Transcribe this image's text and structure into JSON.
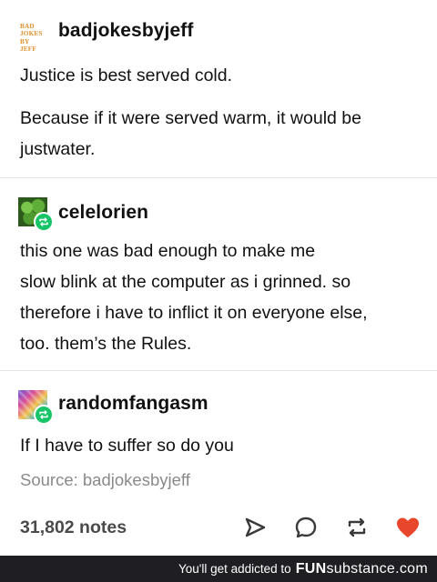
{
  "post_1": {
    "avatar_text": [
      "BAD",
      "JOKES",
      "BY JEFF"
    ],
    "username": "badjokesbyjeff",
    "lines": [
      "Justice is best served cold."
    ],
    "para2_lines": [
      "Because if it were served warm, it would be",
      "justwater."
    ]
  },
  "reblog_1": {
    "username": "celelorien",
    "lines": [
      "this one was bad enough to make me",
      "slow blink at the computer as i grinned. so",
      "therefore i have to inflict it on everyone else,",
      "too. them’s the Rules."
    ]
  },
  "reblog_2": {
    "username": "randomfangasm",
    "lines": [
      "If I have to suffer so do you"
    ]
  },
  "source": "Source: badjokesbyjeff",
  "notes": "31,802 notes",
  "actions": {
    "share_icon": "paper-plane-icon",
    "reply_icon": "speech-bubble-icon",
    "reblog_icon": "reblog-icon",
    "like_icon": "heart-icon",
    "like_color": "#e8472b"
  },
  "footer": {
    "tagline": "You'll get addicted to",
    "brand_fun": "FUN",
    "brand_sub": "substance",
    "brand_suffix": ".com"
  },
  "colors": {
    "reblog_badge": "#17c467",
    "footer_bg": "#1f1f23",
    "avatar_text": "#e0912b"
  }
}
